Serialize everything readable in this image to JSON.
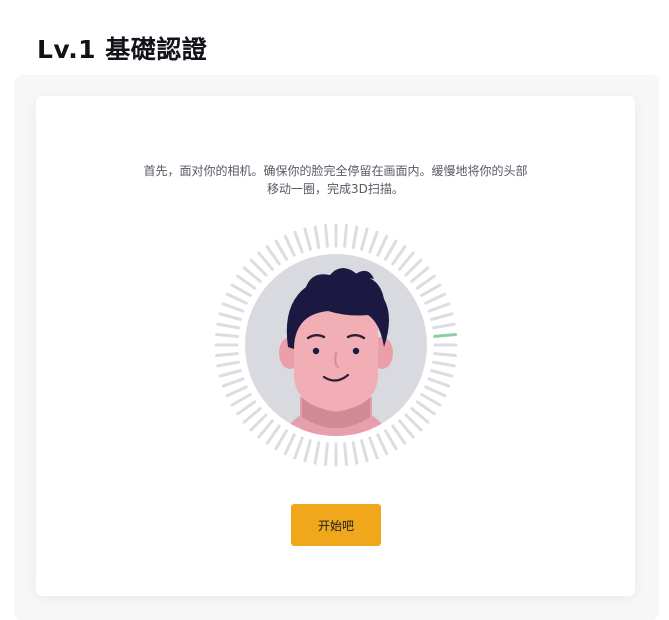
{
  "header": {
    "title": "Lv.1 基礎認證"
  },
  "instruction": {
    "line1": "首先，面对你的相机。确保你的脸完全停留在画面内。缓慢地将你的头部",
    "line2": "移动一圈，完成3D扫描。"
  },
  "scanner": {
    "icon": "face-scan-icon",
    "progress": 0.02
  },
  "actions": {
    "start_label": "开始吧"
  },
  "colors": {
    "accent": "#f0a71b",
    "tick_inactive": "#dcdde1",
    "tick_active": "#8dcea2",
    "face_bg": "#d9dae0",
    "skin": "#f1aeb5",
    "hair": "#1b1842"
  }
}
